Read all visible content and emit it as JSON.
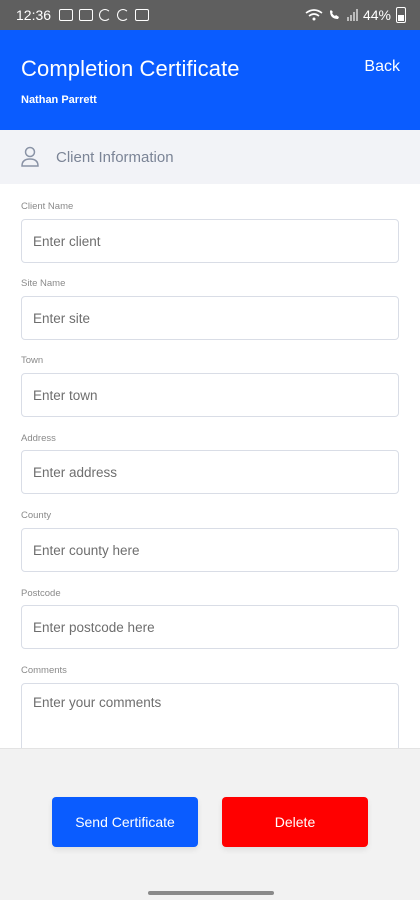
{
  "status_bar": {
    "time": "12:36",
    "battery": "44%"
  },
  "header": {
    "title": "Completion Certificate",
    "back_label": "Back",
    "user_name": "Nathan Parrett"
  },
  "section": {
    "title": "Client Information"
  },
  "form": {
    "client_name": {
      "label": "Client Name",
      "placeholder": "Enter client"
    },
    "site_name": {
      "label": "Site Name",
      "placeholder": "Enter site"
    },
    "town": {
      "label": "Town",
      "placeholder": "Enter town"
    },
    "address": {
      "label": "Address",
      "placeholder": "Enter address"
    },
    "county": {
      "label": "County",
      "placeholder": "Enter county here"
    },
    "postcode": {
      "label": "Postcode",
      "placeholder": "Enter postcode here"
    },
    "comments": {
      "label": "Comments",
      "placeholder": "Enter your comments"
    }
  },
  "footer": {
    "send_label": "Send Certificate",
    "delete_label": "Delete"
  },
  "colors": {
    "primary": "#0a5cff",
    "danger": "#ff0000",
    "section_bg": "#f2f3f7"
  }
}
